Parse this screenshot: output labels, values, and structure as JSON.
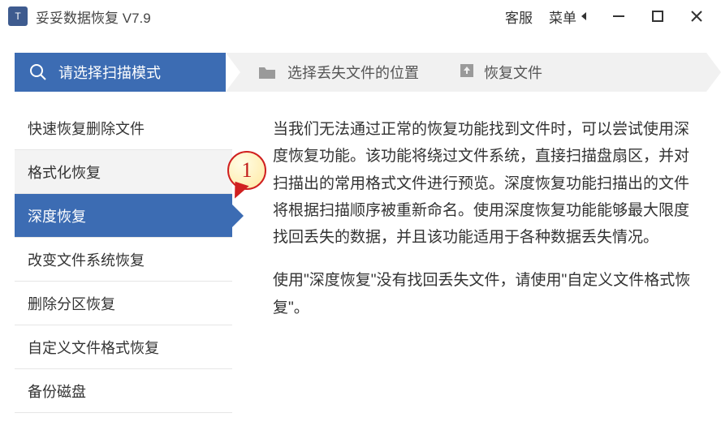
{
  "titlebar": {
    "app_name": "妥妥数据恢复",
    "version": "V7.9",
    "service": "客服",
    "menu": "菜单"
  },
  "steps": {
    "s1": "请选择扫描模式",
    "s2": "选择丢失文件的位置",
    "s3": "恢复文件"
  },
  "sidebar": {
    "items": [
      "快速恢复删除文件",
      "格式化恢复",
      "深度恢复",
      "改变文件系统恢复",
      "删除分区恢复",
      "自定义文件格式恢复",
      "备份磁盘"
    ]
  },
  "callout": {
    "num": "1"
  },
  "content": {
    "p1": "当我们无法通过正常的恢复功能找到文件时，可以尝试使用深度恢复功能。该功能将绕过文件系统，直接扫描盘扇区，并对扫描出的常用格式文件进行预览。深度恢复功能扫描出的文件将根据扫描顺序被重新命名。使用深度恢复功能能够最大限度找回丢失的数据，并且该功能适用于各种数据丢失情况。",
    "p2": "使用\"深度恢复\"没有找回丢失文件，请使用\"自定义文件格式恢复\"。"
  }
}
